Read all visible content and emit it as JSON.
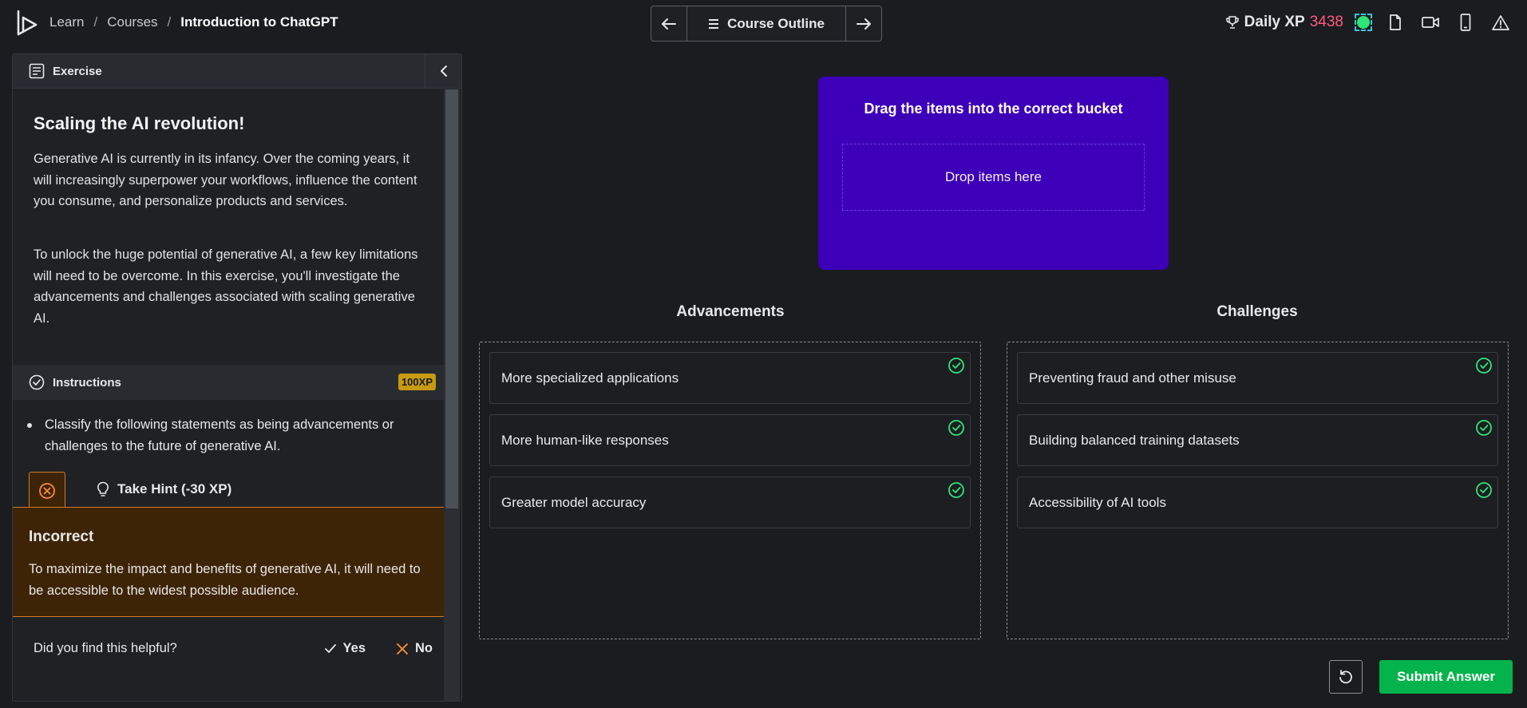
{
  "breadcrumb": {
    "learn": "Learn",
    "sep1": "/",
    "courses": "Courses",
    "sep2": "/",
    "current": "Introduction to ChatGPT"
  },
  "nav": {
    "outline_label": "Course Outline"
  },
  "header_right": {
    "xp_label": "Daily XP",
    "xp_value": "3438"
  },
  "left_panel": {
    "tab_label": "Exercise",
    "exercise_title": "Scaling the AI revolution!",
    "paragraph1": "Generative AI is currently in its infancy. Over the coming years, it will increasingly superpower your workflows, influence the content you consume, and personalize products and services.",
    "paragraph2": "To unlock the huge potential of generative AI, a few key limitations will need to be overcome. In this exercise, you'll investigate the advancements and challenges associated with scaling generative AI.",
    "instructions_label": "Instructions",
    "xp_badge": "100XP",
    "instruction_item": "Classify the following statements as being advancements or challenges to the future of generative AI.",
    "hint_label": "Take Hint (-30 XP)",
    "feedback": {
      "title": "Incorrect",
      "text": "To maximize the impact and benefits of generative AI, it will need to be accessible to the widest possible audience."
    },
    "helpful": {
      "question": "Did you find this helpful?",
      "yes": "Yes",
      "no": "No"
    }
  },
  "exercise": {
    "drag_heading": "Drag the items into the correct bucket",
    "drop_placeholder": "Drop items here",
    "buckets": [
      {
        "title": "Advancements",
        "items": [
          "More specialized applications",
          "More human-like responses",
          "Greater model accuracy"
        ]
      },
      {
        "title": "Challenges",
        "items": [
          "Preventing fraud and other misuse",
          "Building balanced training datasets",
          "Accessibility of AI tools"
        ]
      }
    ],
    "submit_label": "Submit Answer"
  },
  "colors": {
    "accent_purple": "#3d00b8",
    "xp_pink": "#ff5b7f",
    "success_green": "#04b34c",
    "check_green": "#2ee577",
    "incorrect_orange": "#d07a2c",
    "badge_gold": "#c79a12"
  }
}
